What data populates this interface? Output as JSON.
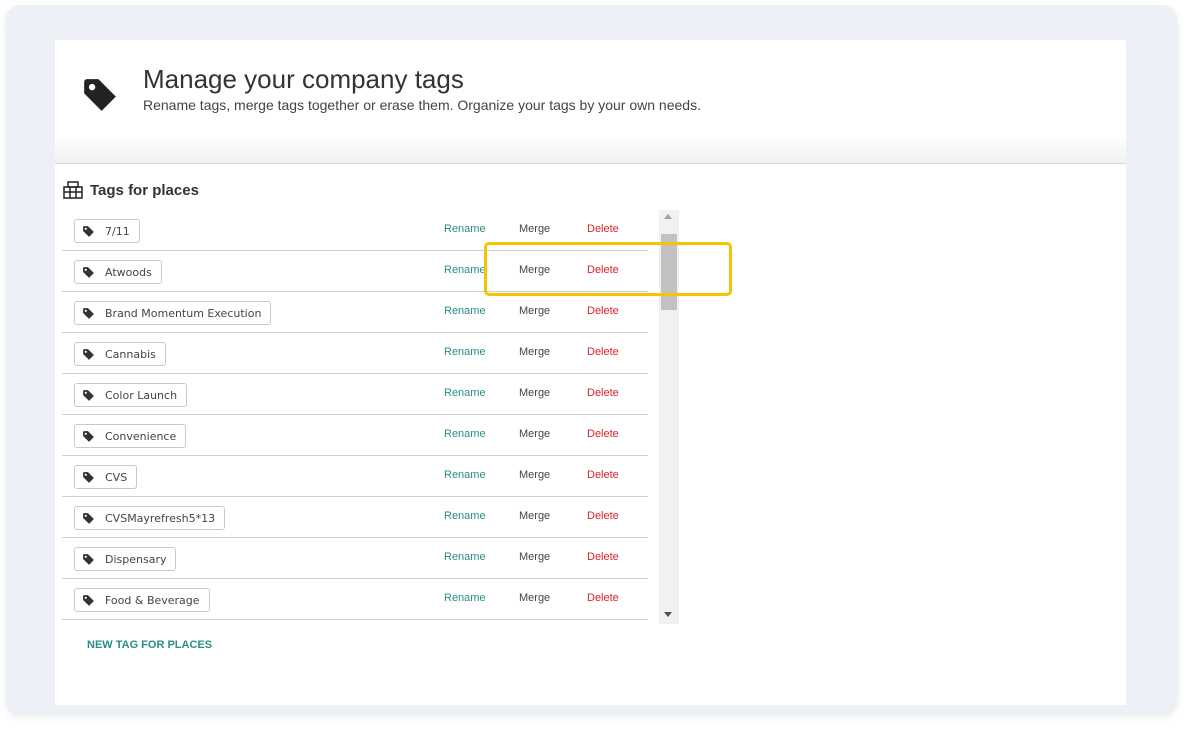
{
  "header": {
    "title": "Manage your company tags",
    "subtitle": "Rename tags, merge tags together or erase them. Organize your tags by your own needs.",
    "icon": "tag-icon"
  },
  "section": {
    "title": "Tags for places",
    "icon": "building-icon"
  },
  "actions": {
    "rename": "Rename",
    "merge": "Merge",
    "delete": "Delete"
  },
  "tags": [
    "7/11",
    "Atwoods",
    "Brand Momentum Execution",
    "Cannabis",
    "Color Launch",
    "Convenience",
    "CVS",
    "CVSMayrefresh5*13",
    "Dispensary",
    "Food & Beverage"
  ],
  "new_tag_label": "NEW TAG FOR PLACES",
  "colors": {
    "rename": "#2a8d86",
    "delete": "#d9232d",
    "highlight": "#f5c400"
  }
}
